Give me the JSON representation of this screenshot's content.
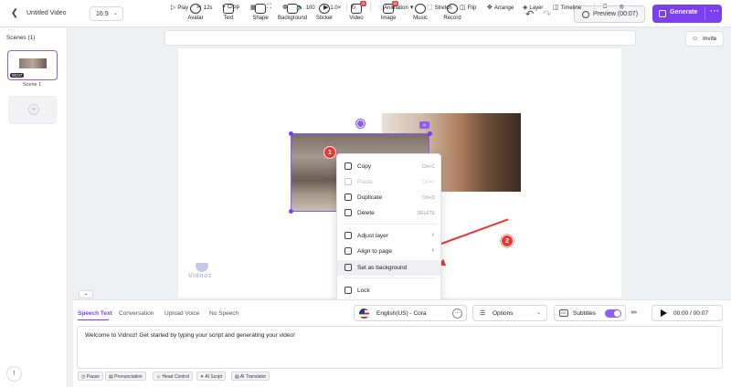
{
  "header": {
    "project_title": "Untitled Video",
    "aspect_ratio": "16:9",
    "tools": [
      {
        "label": "Avatar",
        "icon": "avatar-icon"
      },
      {
        "label": "Text",
        "icon": "text-icon"
      },
      {
        "label": "Shape",
        "icon": "shape-icon"
      },
      {
        "label": "Background",
        "icon": "background-icon"
      },
      {
        "label": "Sticker",
        "icon": "sticker-icon"
      },
      {
        "label": "Video",
        "icon": "video-icon",
        "badge": "AI"
      },
      {
        "label": "Image",
        "icon": "image-icon",
        "badge": "AI"
      },
      {
        "label": "Music",
        "icon": "music-icon"
      },
      {
        "label": "Record",
        "icon": "record-icon"
      }
    ],
    "preview_label": "Preview (00:07)",
    "generate_label": "Generate",
    "generate_more": "···"
  },
  "left_panel": {
    "title": "Scenes (1)",
    "scene_duration": "00:07",
    "scene_label": "Scene 1",
    "add_symbol": "+"
  },
  "invite_label": "Invite",
  "toolbar": {
    "play": "Play",
    "duration": "12s",
    "crop": "Crop",
    "opacity": "100",
    "speed": "1.0×",
    "animation": "Animation",
    "stretch": "Stretch",
    "flip": "Flip",
    "arrange": "Arrange",
    "layer": "Layer",
    "timeline": "Timeline"
  },
  "canvas": {
    "ai_tag": "AI",
    "watermark": "Vidnoz",
    "marker_1": "1",
    "marker_2": "2"
  },
  "context_menu": {
    "copy": {
      "label": "Copy",
      "shortcut": "Ctrl+C"
    },
    "paste": {
      "label": "Paste",
      "shortcut": "Ctrl+V"
    },
    "duplicate": {
      "label": "Duplicate",
      "shortcut": "Ctrl+D"
    },
    "delete": {
      "label": "Delete",
      "shortcut": "DELETE"
    },
    "adjust_layer": "Adjust layer",
    "align_to_page": "Align to page",
    "set_as_background": "Set as background",
    "lock": "Lock"
  },
  "speech_panel": {
    "tabs": [
      "Speech Text",
      "Conversation",
      "Upload Voice",
      "No Speech"
    ],
    "active_tab": "Speech Text",
    "voice": "English(US) - Cora",
    "options_label": "Options",
    "subtitles_label": "Subtitles",
    "subtitles_on": true,
    "time": "00:00 / 00:07",
    "script_text": "Welcome to Vidnoz! Get started by typing your script and generating your video!",
    "chips": [
      "Pause",
      "Pronunciation",
      "Head Control",
      "AI Script",
      "AI Translator"
    ]
  },
  "colors": {
    "accent": "#7b3ff2",
    "marker": "#e53935"
  }
}
